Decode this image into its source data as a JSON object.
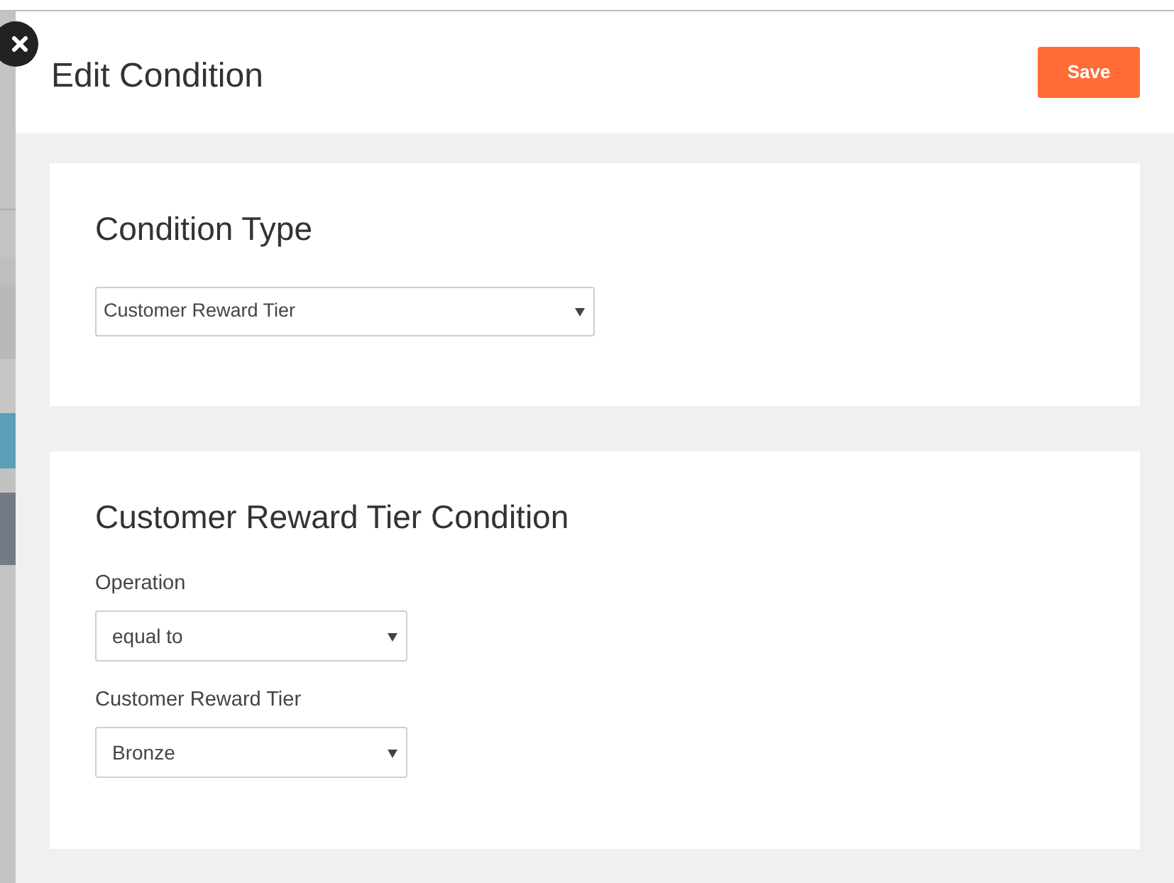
{
  "dialog": {
    "title": "Edit Condition",
    "save_button": "Save"
  },
  "sections": [
    {
      "title": "Condition Type",
      "fields": [
        {
          "value": "Customer Reward Tier"
        }
      ]
    },
    {
      "title": "Customer Reward Tier Condition",
      "fields": [
        {
          "label": "Operation",
          "value": "equal to"
        },
        {
          "label": "Customer Reward Tier",
          "value": "Bronze"
        }
      ]
    }
  ]
}
